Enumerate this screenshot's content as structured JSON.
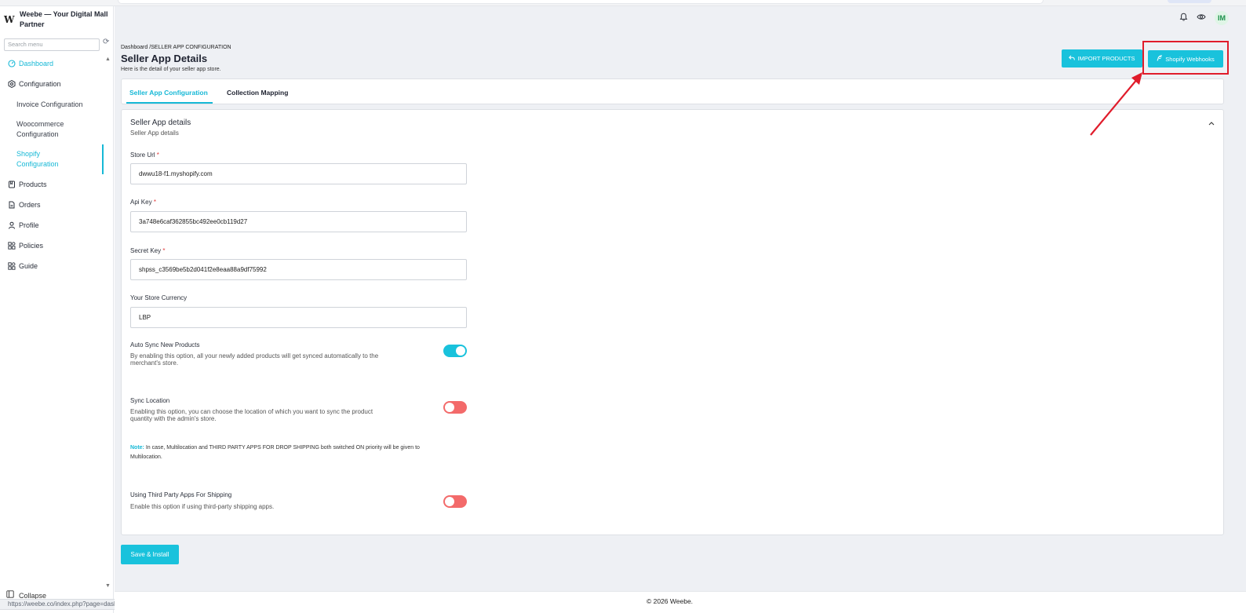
{
  "brand": {
    "logo": "W",
    "title": "Weebe — Your Digital Mall Partner"
  },
  "sidebar": {
    "search_placeholder": "Search menu",
    "items": [
      {
        "label": "Dashboard",
        "icon": "dashboard-icon"
      },
      {
        "label": "Configuration",
        "icon": "gear-hex-icon"
      },
      {
        "label": "Invoice Configuration"
      },
      {
        "label": "Woocommerce Configuration"
      },
      {
        "label": "Shopify Configuration"
      },
      {
        "label": "Products",
        "icon": "bookmark-icon"
      },
      {
        "label": "Orders",
        "icon": "document-icon"
      },
      {
        "label": "Profile",
        "icon": "user-icon"
      },
      {
        "label": "Policies",
        "icon": "grid-icon"
      },
      {
        "label": "Guide",
        "icon": "grid-icon"
      }
    ],
    "collapse_label": "Collapse",
    "url_hint": "https://weebe.co/index.php?page=dashboard"
  },
  "header": {
    "avatar_initials": "IM"
  },
  "page": {
    "breadcrumb": "Dashboard /SELLER APP CONFIGURATION",
    "title": "Seller App Details",
    "subtitle": "Here is the detail of your seller app store.",
    "import_button": "IMPORT PRODUCTS",
    "webhooks_button": "Shopify Webhooks"
  },
  "tabs": [
    "Seller App Configuration",
    "Collection Mapping"
  ],
  "card": {
    "title": "Seller App details",
    "subtitle": "Seller App details",
    "fields": [
      {
        "label": "Store Url",
        "required": true,
        "value": "dwwu18-f1.myshopify.com"
      },
      {
        "label": "Api Key",
        "required": true,
        "value": "3a748e6caf362855bc492ee0cb119d27"
      },
      {
        "label": "Secret Key",
        "required": true,
        "value": "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"
      },
      {
        "label": "Your Store Currency",
        "required": false,
        "value": "LBP"
      }
    ],
    "options": [
      {
        "title": "Auto Sync New Products",
        "desc": "By enabling this option, all your newly added products will get synced automatically to the merchant's store.",
        "enabled": true
      },
      {
        "title": "Sync Location",
        "desc": "Enabling this option, you can choose the location of which you want to sync the product quantity with the admin's store.",
        "enabled": false
      },
      {
        "title": "Using Third Party Apps For Shipping",
        "desc": "Enable this option if using third-party shipping apps.",
        "enabled": false
      }
    ],
    "note_label": "Note:",
    "note_text": " In case, Multilocation and THIRD PARTY APPS FOR DROP SHIPPING both switched ON priority will be given to Multilocation."
  },
  "save_button": "Save & Install",
  "footer": "© 2026 Weebe.",
  "colors": {
    "accent": "#19c2dc",
    "toggle_off": "#f36a6a",
    "highlight": "#e01c2b"
  }
}
